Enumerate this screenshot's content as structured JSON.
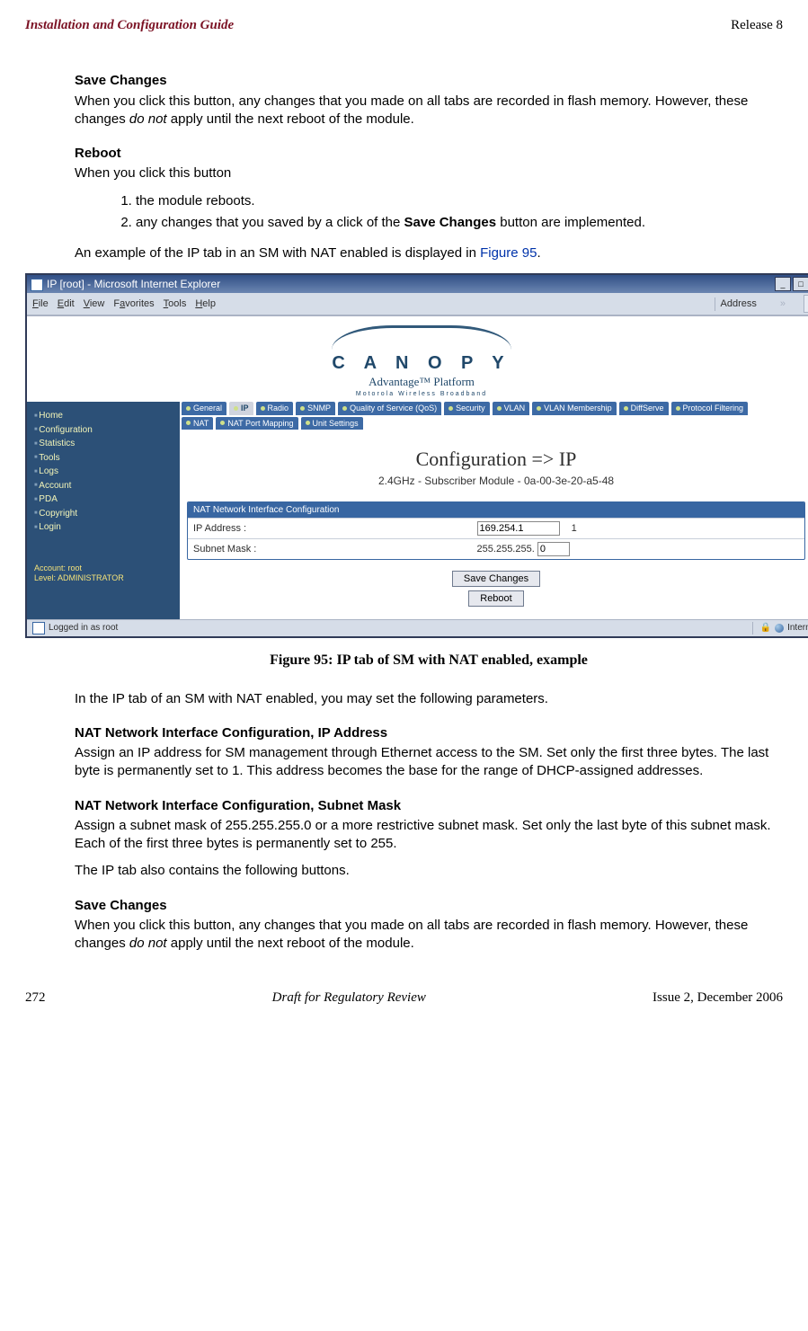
{
  "header": {
    "left": "Installation and Configuration Guide",
    "right": "Release 8"
  },
  "sections": {
    "save1_head": "Save Changes",
    "save1_body_a": "When you click this button, any changes that you made on all tabs are recorded in flash memory. However, these changes ",
    "save1_body_em": "do not",
    "save1_body_b": " apply until the next reboot of the module.",
    "reboot_head": "Reboot",
    "reboot_intro": "When you click this button",
    "reboot_item1": "the module reboots.",
    "reboot_item2_a": "any changes that you saved by a click of the ",
    "reboot_item2_bold": "Save Changes",
    "reboot_item2_b": " button are implemented.",
    "example_a": "An example of the IP tab in an SM with NAT enabled is displayed in ",
    "example_link": "Figure 95",
    "example_b": ".",
    "fig_caption": "Figure 95: IP tab of SM with NAT enabled, example",
    "after_fig": "In the IP tab of an SM with NAT enabled, you may set the following parameters.",
    "nat_ip_head": "NAT Network Interface Configuration, IP Address",
    "nat_ip_body": "Assign an IP address for SM management through Ethernet access to the SM. Set only the first three bytes. The last byte is permanently set to 1. This address becomes the base for the range of DHCP-assigned addresses.",
    "nat_mask_head": "NAT Network Interface Configuration, Subnet Mask",
    "nat_mask_body": "Assign a subnet mask of 255.255.255.0 or a more restrictive subnet mask. Set only the last byte of this subnet mask. Each of the first three bytes is permanently set to 255.",
    "also": "The IP tab also contains the following buttons.",
    "save2_head": "Save Changes",
    "save2_body_a": "When you click this button, any changes that you made on all tabs are recorded in flash memory. However, these changes ",
    "save2_body_em": "do not",
    "save2_body_b": " apply until the next reboot of the module."
  },
  "screenshot": {
    "window_title": "IP [root] - Microsoft Internet Explorer",
    "menu": {
      "file": "File",
      "edit": "Edit",
      "view": "View",
      "favorites": "Favorites",
      "tools": "Tools",
      "help": "Help",
      "address": "Address"
    },
    "logo": {
      "name": "C A N O P Y",
      "tag": "Advantage™ Platform",
      "sub": "Motorola Wireless Broadband"
    },
    "sidebar": {
      "items": [
        "Home",
        "Configuration",
        "Statistics",
        "Tools",
        "Logs",
        "Account",
        "PDA",
        "Copyright",
        "Login"
      ],
      "account_line1": "Account: root",
      "account_line2": "Level: ADMINISTRATOR"
    },
    "tabs_row1": [
      "General",
      "IP",
      "Radio",
      "SNMP",
      "Quality of Service (QoS)",
      "Security",
      "VLAN",
      "VLAN Membership",
      "DiffServe",
      "Protocol Filtering"
    ],
    "tabs_row2": [
      "NAT",
      "NAT Port Mapping",
      "Unit Settings"
    ],
    "selected_tab": "IP",
    "page_title": "Configuration => IP",
    "page_sub": "2.4GHz - Subscriber Module - 0a-00-3e-20-a5-48",
    "panel_title": "NAT Network Interface Configuration",
    "row_ip_label": "IP Address :",
    "row_ip_value": "169.254.1",
    "row_ip_last_octet": "1",
    "row_mask_label": "Subnet Mask :",
    "row_mask_value": "255.255.255.",
    "row_mask_last_octet": "0",
    "btn_save": "Save Changes",
    "btn_reboot": "Reboot",
    "status_left": "Logged in as root",
    "status_right": "Internet"
  },
  "footer": {
    "left": "272",
    "center": "Draft for Regulatory Review",
    "right": "Issue 2, December 2006"
  }
}
